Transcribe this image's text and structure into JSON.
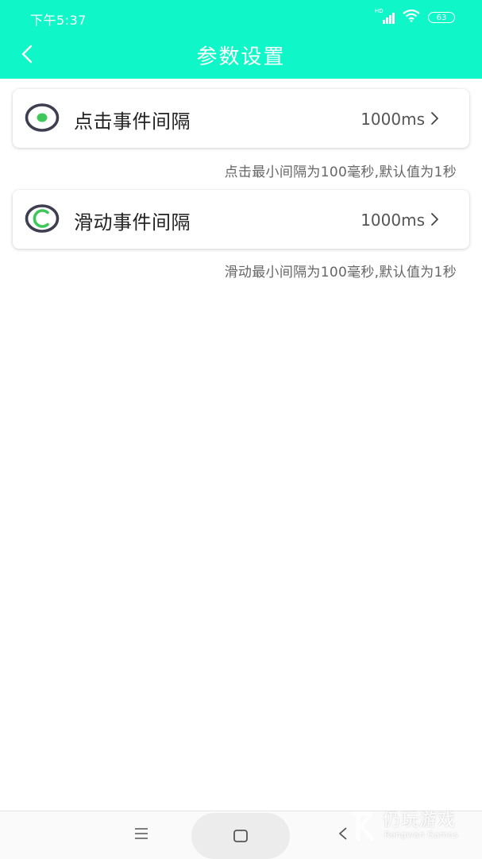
{
  "status_bar": {
    "time": "下午5:37",
    "network_label": "HD",
    "battery": "63"
  },
  "header": {
    "title": "参数设置",
    "back_icon": "chevron-left-icon",
    "color": "#0ff6c9"
  },
  "settings": [
    {
      "label": "点击事件间隔",
      "value": "1000ms",
      "hint": "点击最小间隔为100毫秒,默认值为1秒",
      "icon": "tap-dot-icon",
      "icon_color": "#3ec85a"
    },
    {
      "label": "滑动事件间隔",
      "value": "1000ms",
      "hint": "滑动最小间隔为100毫秒,默认值为1秒",
      "icon": "swipe-arc-icon",
      "icon_color": "#3ec85a"
    }
  ],
  "system_nav": {
    "menu_icon": "menu-icon",
    "home_icon": "home-square-icon",
    "back_icon": "back-triangle-icon"
  },
  "watermark": {
    "title": "仍玩游戏",
    "subtitle": "Rengwan Games"
  }
}
